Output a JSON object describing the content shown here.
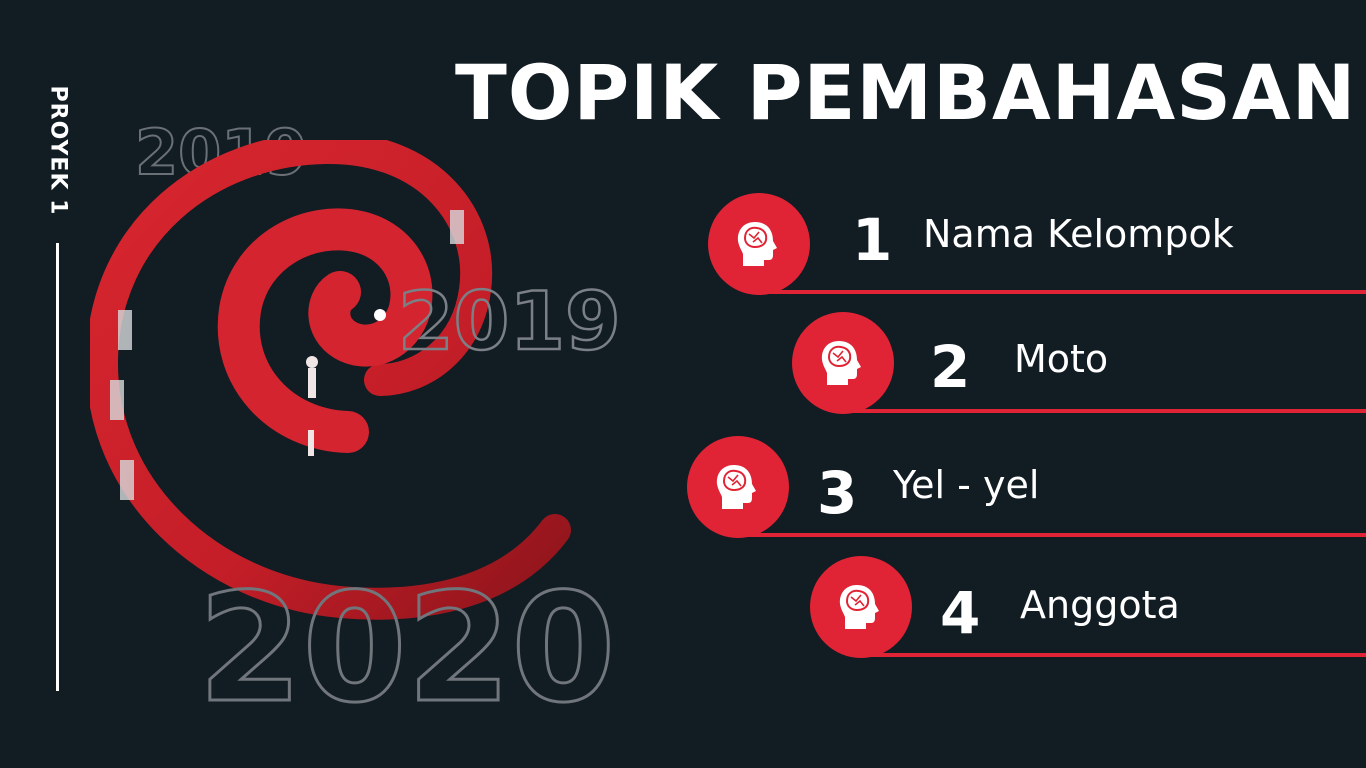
{
  "side_label": "PROYEK 1",
  "title": "TOPIK PEMBAHASAN",
  "years": {
    "top": "2019",
    "middle": "2019",
    "bottom": "2020"
  },
  "colors": {
    "background": "#111c23",
    "accent": "#e02435",
    "text": "#ffffff"
  },
  "topics": [
    {
      "number": "1",
      "label": "Nama Kelompok",
      "icon": "brain-head-icon"
    },
    {
      "number": "2",
      "label": "Moto",
      "icon": "brain-head-icon"
    },
    {
      "number": "3",
      "label": "Yel - yel",
      "icon": "brain-head-icon"
    },
    {
      "number": "4",
      "label": "Anggota",
      "icon": "brain-head-icon"
    }
  ]
}
